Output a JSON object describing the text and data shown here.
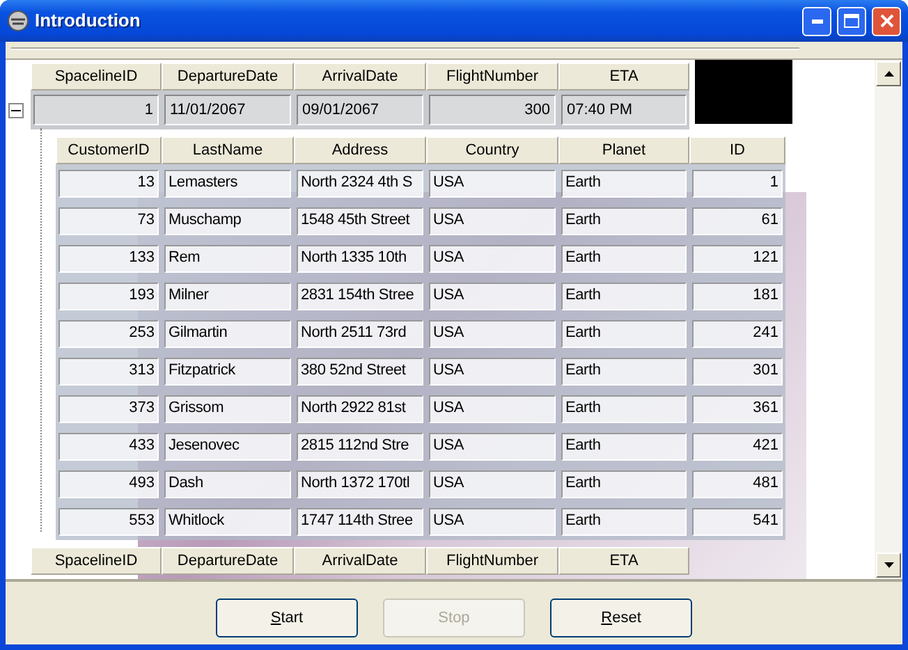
{
  "window": {
    "title": "Introduction"
  },
  "grid": {
    "groups": [
      {
        "columns": [
          {
            "label": "SpacelineID",
            "kind": "number"
          },
          {
            "label": "DepartureDate",
            "kind": "text"
          },
          {
            "label": "ArrivalDate",
            "kind": "text"
          },
          {
            "label": "FlightNumber",
            "kind": "number"
          },
          {
            "label": "ETA",
            "kind": "text"
          }
        ],
        "row": {
          "expanded": true,
          "cells": [
            "1",
            "11/01/2067",
            "09/01/2067",
            "300",
            "07:40 PM"
          ]
        },
        "child_band": {
          "columns": [
            {
              "label": "CustomerID",
              "kind": "number"
            },
            {
              "label": "LastName",
              "kind": "text"
            },
            {
              "label": "Address",
              "kind": "text"
            },
            {
              "label": "Country",
              "kind": "text"
            },
            {
              "label": "Planet",
              "kind": "text"
            },
            {
              "label": "ID",
              "kind": "number"
            }
          ],
          "rows": [
            [
              "13",
              "Lemasters",
              "North 2324 4th S",
              "USA",
              "Earth",
              "1"
            ],
            [
              "73",
              "Muschamp",
              "1548 45th Street",
              "USA",
              "Earth",
              "61"
            ],
            [
              "133",
              "Rem",
              "North 1335 10th",
              "USA",
              "Earth",
              "121"
            ],
            [
              "193",
              "Milner",
              "2831 154th Stree",
              "USA",
              "Earth",
              "181"
            ],
            [
              "253",
              "Gilmartin",
              "North 2511 73rd",
              "USA",
              "Earth",
              "241"
            ],
            [
              "313",
              "Fitzpatrick",
              "380 52nd Street",
              "USA",
              "Earth",
              "301"
            ],
            [
              "373",
              "Grissom",
              "North 2922 81st",
              "USA",
              "Earth",
              "361"
            ],
            [
              "433",
              "Jesenovec",
              "2815 112nd Stre",
              "USA",
              "Earth",
              "421"
            ],
            [
              "493",
              "Dash",
              "North 1372 170tl",
              "USA",
              "Earth",
              "481"
            ],
            [
              "553",
              "Whitlock",
              "1747 114th Stree",
              "USA",
              "Earth",
              "541"
            ]
          ]
        }
      },
      {
        "columns": [
          {
            "label": "SpacelineID"
          },
          {
            "label": "DepartureDate"
          },
          {
            "label": "ArrivalDate"
          },
          {
            "label": "FlightNumber"
          },
          {
            "label": "ETA"
          }
        ]
      }
    ]
  },
  "buttons": [
    {
      "label": "Start",
      "disabled": false
    },
    {
      "label": "Stop",
      "disabled": true
    },
    {
      "label": "Reset",
      "disabled": false
    }
  ]
}
